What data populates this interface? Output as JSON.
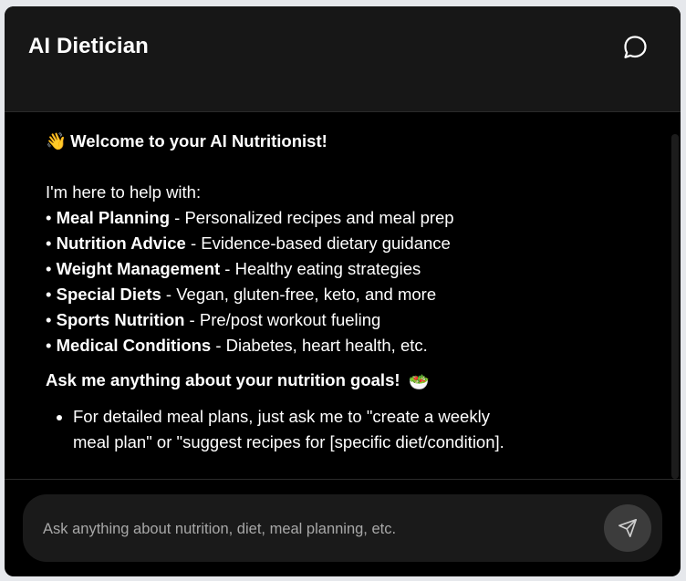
{
  "header": {
    "title": "AI Dietician",
    "chat_icon": "chat-bubble-icon"
  },
  "message": {
    "welcome_emoji": "👋",
    "welcome": "Welcome to your AI Nutritionist!",
    "intro": "I'm here to help with:",
    "bullet_char": "•",
    "features": [
      {
        "name": "Meal Planning",
        "desc": " - Personalized recipes and meal prep"
      },
      {
        "name": "Nutrition Advice",
        "desc": " - Evidence-based dietary guidance"
      },
      {
        "name": "Weight Management",
        "desc": " - Healthy eating strategies"
      },
      {
        "name": "Special Diets",
        "desc": " - Vegan, gluten-free, keto, and more"
      },
      {
        "name": "Sports Nutrition",
        "desc": " - Pre/post workout fueling"
      },
      {
        "name": "Medical Conditions",
        "desc": " - Diabetes, heart health, etc."
      }
    ],
    "cta": "Ask me anything about your nutrition goals!",
    "cta_emoji": "🥗",
    "tips": [
      "For detailed meal plans, just ask me to \"create a weekly meal plan\" or \"suggest recipes for [specific diet/condition]."
    ]
  },
  "input": {
    "placeholder": "Ask anything about nutrition, diet, meal planning, etc.",
    "value": "",
    "send_icon": "send-icon"
  },
  "colors": {
    "background": "#000000",
    "header": "#171717",
    "input_bar": "#1a1a1a",
    "send_button": "#3c3c3c",
    "text": "#ffffff"
  }
}
